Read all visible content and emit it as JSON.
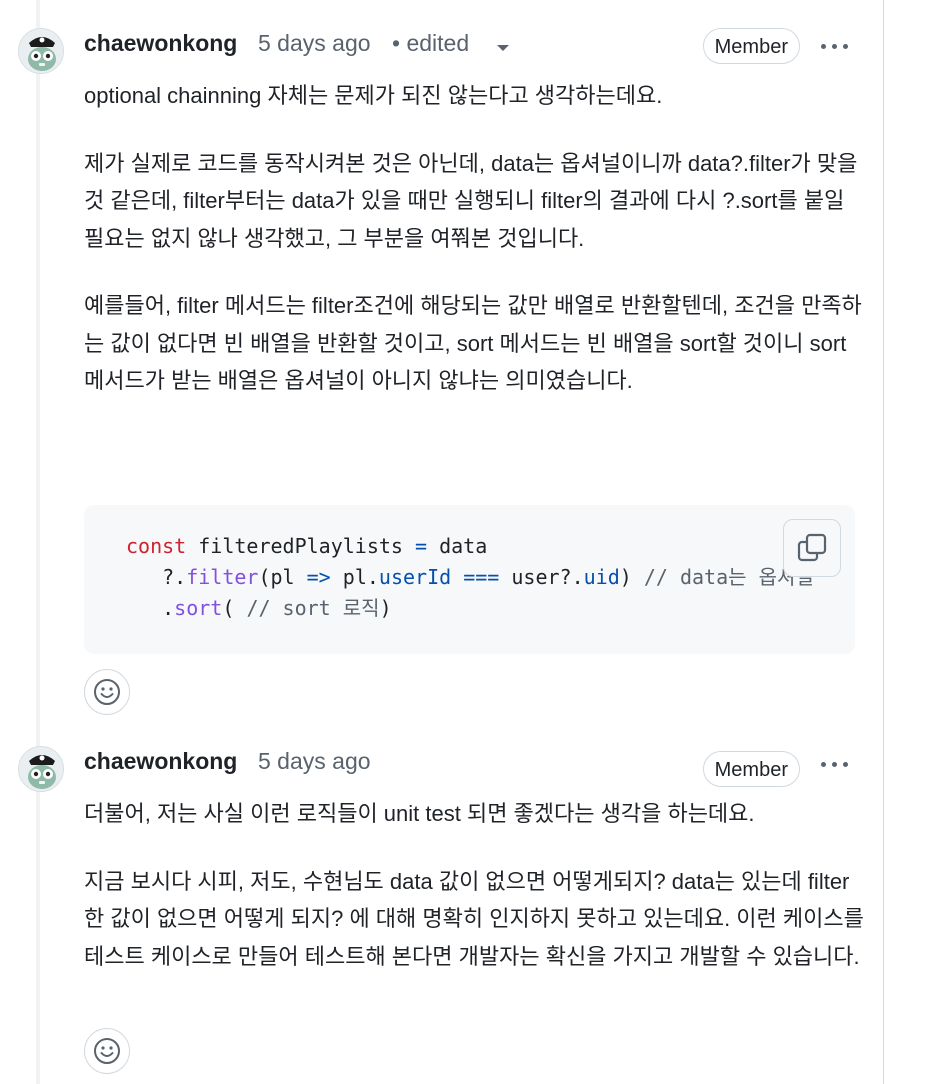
{
  "comments": [
    {
      "author": "chaewonkong",
      "time": "5 days ago",
      "edited": "• edited",
      "badge": "Member",
      "paragraphs": [
        "optional chainning 자체는 문제가 되진 않는다고 생각하는데요.",
        "제가 실제로 코드를 동작시켜본 것은 아닌데, data는 옵셔널이니까 data?.filter가 맞을 것 같은데, filter부터는 data가 있을 때만 실행되니 filter의 결과에 다시 ?.sort를 붙일 필요는 없지 않나 생각했고, 그 부분을 여쭤본 것입니다.",
        "예를들어, filter 메서드는 filter조건에 해당되는 값만 배열로 반환할텐데, 조건을 만족하는 값이 없다면 빈 배열을 반환할 것이고, sort 메서드는 빈 배열을 sort할 것이니 sort 메서드가 받는 배열은 옵셔널이 아니지 않냐는 의미였습니다."
      ],
      "code": {
        "l1_kw": "const",
        "l1_var": " filteredPlaylists ",
        "l1_op": "=",
        "l1_rest": " data",
        "l2_indent": "   ?.",
        "l2_fn": "filter",
        "l2_a": "(pl ",
        "l2_arrow": "=>",
        "l2_b": " pl.",
        "l2_prop": "userId",
        "l2_sp": " ",
        "l2_eq": "===",
        "l2_c": " user?.",
        "l2_uid": "uid",
        "l2_d": ") ",
        "l2_comment": "// data는 옵셔널",
        "l3_indent": "   .",
        "l3_fn": "sort",
        "l3_a": "( ",
        "l3_comment": "// sort 로직",
        "l3_b": ")"
      }
    },
    {
      "author": "chaewonkong",
      "time": "5 days ago",
      "badge": "Member",
      "paragraphs": [
        "더불어, 저는 사실 이런 로직들이 unit test 되면 좋겠다는 생각을 하는데요.",
        "지금 보시다 시피, 저도, 수현님도 data 값이 없으면 어떻게되지? data는 있는데 filter한 값이 없으면 어떻게 되지? 에 대해 명확히 인지하지 못하고 있는데요. 이런 케이스를 테스트 케이스로 만들어 테스트해 본다면 개발자는 확신을 가지고 개발할 수 있습니다."
      ]
    }
  ],
  "icons": [
    "avatar",
    "chevron-down-icon",
    "kebab-icon",
    "copy-icon",
    "smiley-icon"
  ],
  "colors": {
    "text": "#1f2328",
    "muted": "#59636e",
    "border": "#d1d9e0",
    "code_bg": "#f6f8fa",
    "keyword": "#cf222e",
    "function": "#8250df",
    "constant": "#0550ae"
  }
}
